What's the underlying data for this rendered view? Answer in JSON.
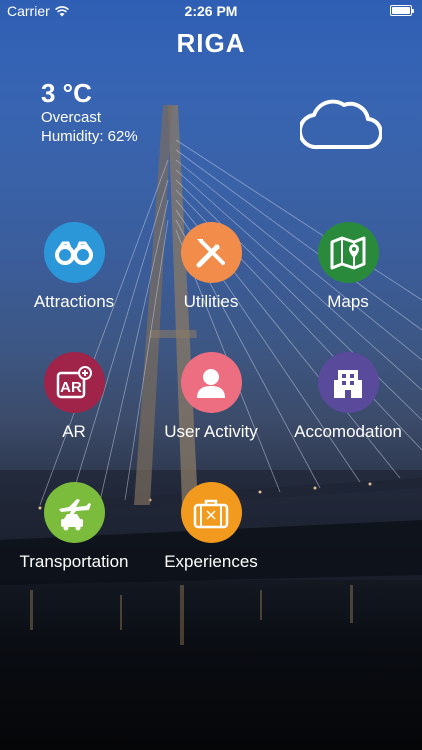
{
  "status_bar": {
    "carrier": "Carrier",
    "time": "2:26 PM"
  },
  "header": {
    "city": "RIGA"
  },
  "weather": {
    "temperature": "3 °C",
    "condition": "Overcast",
    "humidity": "Humidity: 62%",
    "icon": "cloud-icon"
  },
  "menu": {
    "items": [
      {
        "label": "Attractions",
        "icon": "binoculars-icon",
        "color": "#2c97d8"
      },
      {
        "label": "Utilities",
        "icon": "tools-icon",
        "color": "#f28c4b"
      },
      {
        "label": "Maps",
        "icon": "map-icon",
        "color": "#2a8a3c"
      },
      {
        "label": "AR",
        "icon": "ar-icon",
        "color": "#a0234a"
      },
      {
        "label": "User Activity",
        "icon": "user-icon",
        "color": "#ec6e80"
      },
      {
        "label": "Accomodation",
        "icon": "building-icon",
        "color": "#5a4a9c"
      },
      {
        "label": "Transportation",
        "icon": "plane-car-icon",
        "color": "#7cbc3c"
      },
      {
        "label": "Experiences",
        "icon": "suitcase-icon",
        "color": "#f29a1e"
      }
    ]
  }
}
